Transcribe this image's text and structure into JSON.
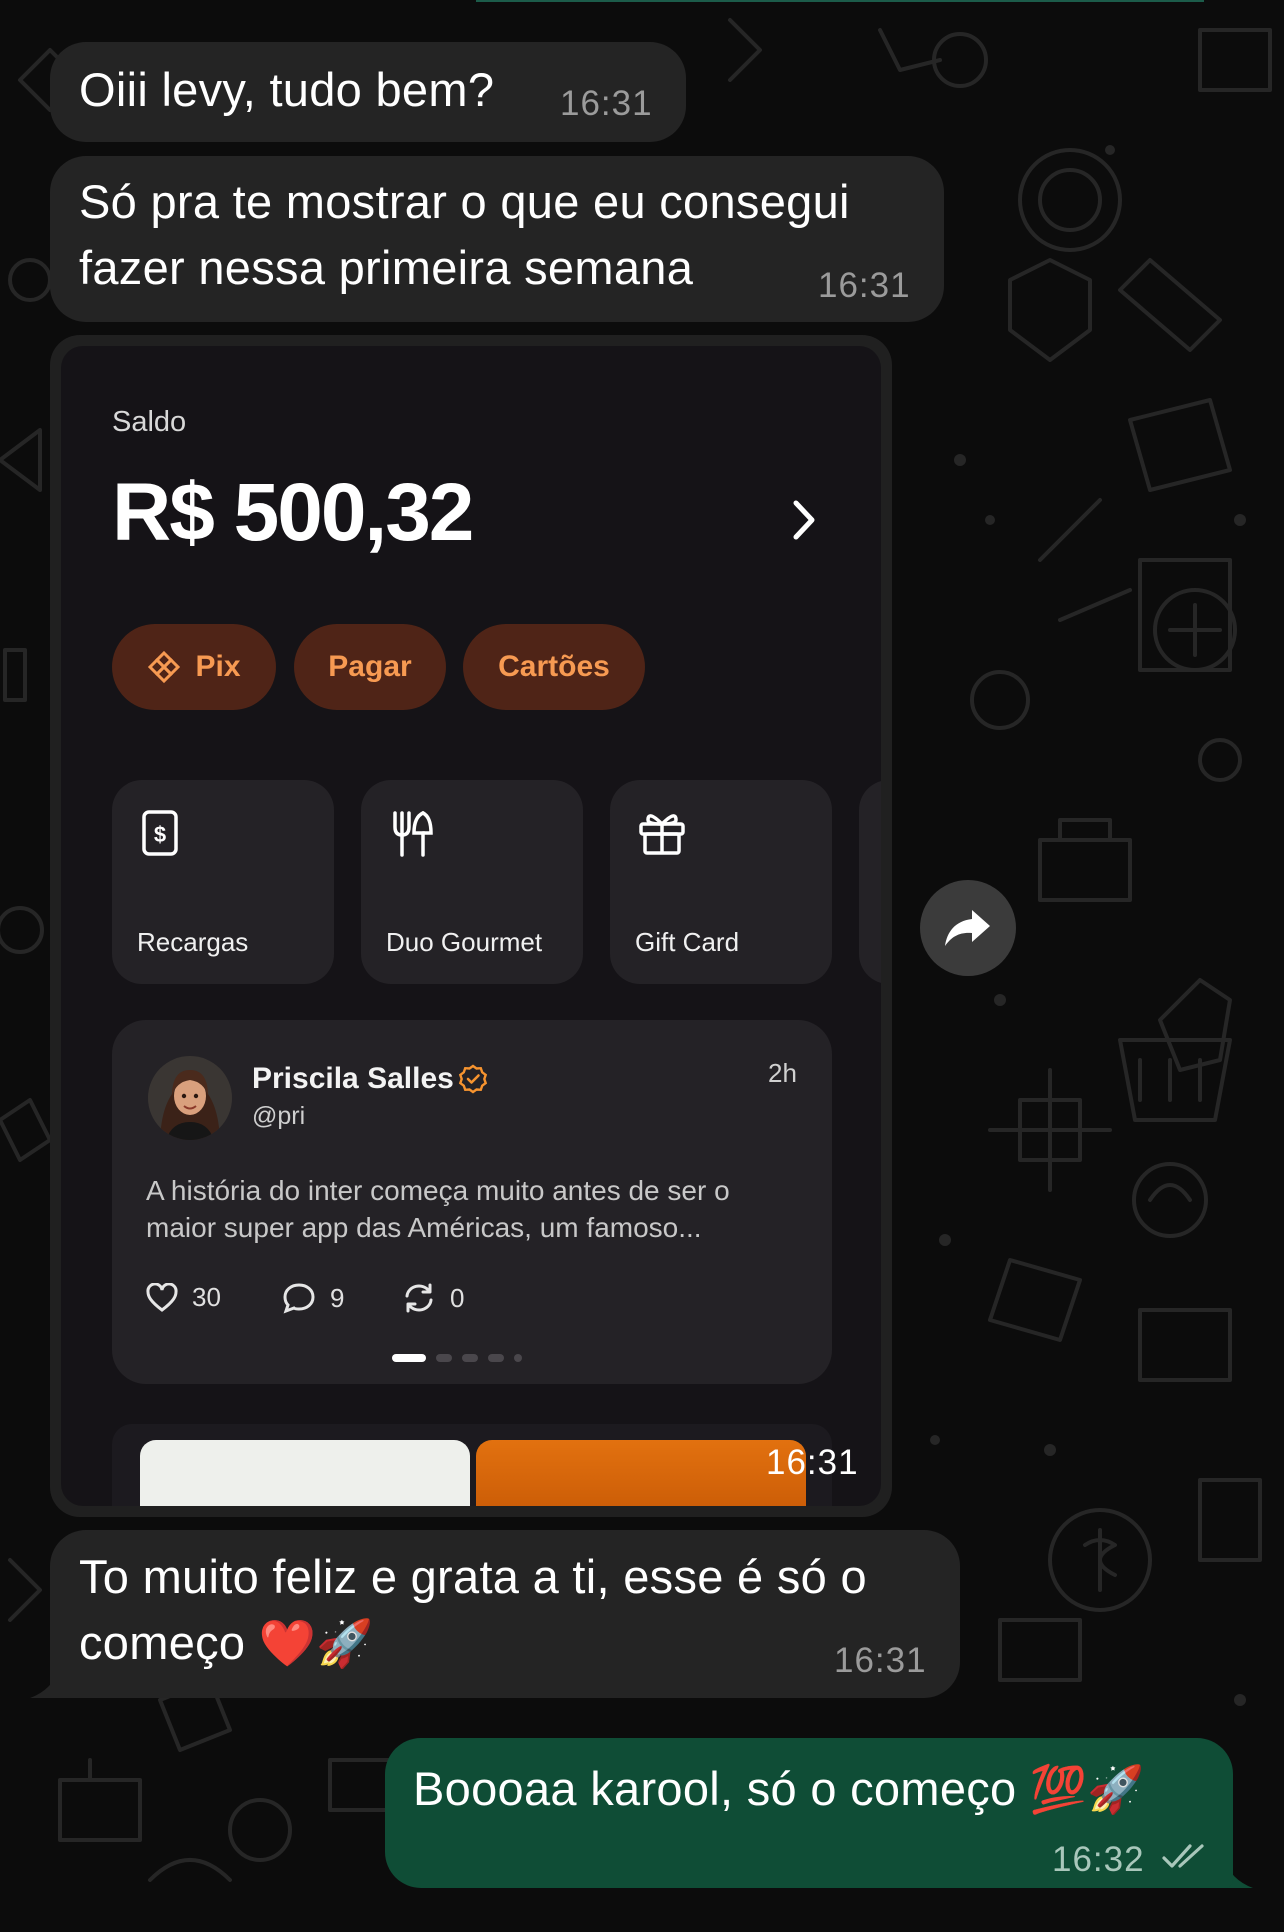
{
  "messages": [
    {
      "text": "Oiii levy, tudo bem?",
      "time": "16:31"
    },
    {
      "line1": "Só pra te mostrar o que eu consegui",
      "line2": "fazer nessa primeira semana",
      "time": "16:31"
    },
    {
      "line1": "To muito feliz e grata a ti, esse é só o",
      "line2": "começo",
      "emoji": "❤️🚀",
      "time": "16:31"
    }
  ],
  "image_message": {
    "time": "16:31",
    "app": {
      "balance_label": "Saldo",
      "balance_value": "R$ 500,32",
      "pills": [
        {
          "label": "Pix",
          "icon": "pix-icon"
        },
        {
          "label": "Pagar"
        },
        {
          "label": "Cartões"
        }
      ],
      "tiles": [
        {
          "label": "Recargas",
          "icon": "phone-recharge-icon"
        },
        {
          "label": "Duo Gourmet",
          "icon": "cutlery-icon"
        },
        {
          "label": "Gift Card",
          "icon": "gift-icon"
        }
      ],
      "post": {
        "name": "Priscila Salles",
        "handle": "@pri",
        "time": "2h",
        "text": "A história do inter começa muito antes de ser o maior super app das Américas, um famoso...",
        "likes": "30",
        "comments": "9",
        "reposts": "0"
      }
    }
  },
  "outgoing": {
    "text": "Boooaa karool, só o começo",
    "emoji": "💯🚀",
    "time": "16:32",
    "status": "read"
  },
  "colors": {
    "incoming_bubble": "#242424",
    "outgoing_bubble": "#0f4d36",
    "accent_orange": "#f79a52",
    "pill_bg": "#4f2417"
  }
}
